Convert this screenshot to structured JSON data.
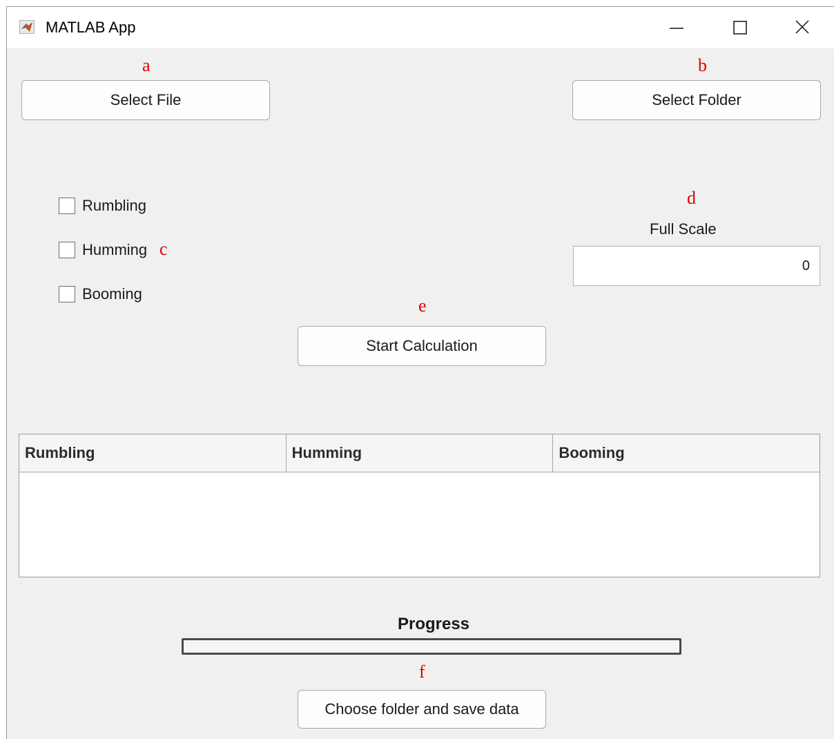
{
  "window": {
    "title": "MATLAB App",
    "controls": {
      "minimize": "—",
      "maximize": "☐",
      "close": "✕"
    }
  },
  "annotations": {
    "a": "a",
    "b": "b",
    "c": "c",
    "d": "d",
    "e": "e",
    "f": "f"
  },
  "buttons": {
    "select_file": "Select File",
    "select_folder": "Select Folder",
    "start_calculation": "Start Calculation",
    "save_data": "Choose folder and save data"
  },
  "checkboxes": [
    {
      "label": "Rumbling",
      "checked": false
    },
    {
      "label": "Humming",
      "checked": false
    },
    {
      "label": "Booming",
      "checked": false
    }
  ],
  "full_scale": {
    "label": "Full Scale",
    "value": "0"
  },
  "table": {
    "columns": [
      "Rumbling",
      "Humming",
      "Booming"
    ],
    "rows": []
  },
  "progress": {
    "label": "Progress",
    "value": 0
  },
  "colors": {
    "annotation": "#e00000",
    "background": "#f0f0f0"
  }
}
